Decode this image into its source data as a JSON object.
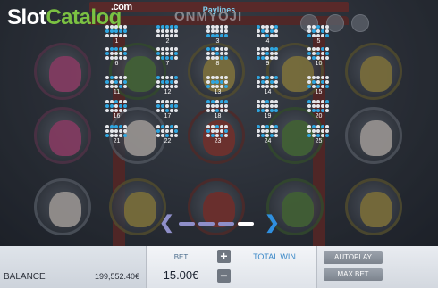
{
  "logo": {
    "slot": "Slot",
    "catalog": "Catalog",
    "com": ".com"
  },
  "game_title": "ONMYOJI",
  "paylines": {
    "title": "Paylines",
    "lines": [
      {
        "num": "1",
        "rows": [
          1,
          1,
          1,
          1,
          1
        ]
      },
      {
        "num": "2",
        "rows": [
          0,
          0,
          0,
          0,
          0
        ]
      },
      {
        "num": "3",
        "rows": [
          2,
          2,
          2,
          2,
          2
        ]
      },
      {
        "num": "4",
        "rows": [
          0,
          1,
          2,
          1,
          0
        ]
      },
      {
        "num": "5",
        "rows": [
          2,
          1,
          0,
          1,
          2
        ]
      },
      {
        "num": "6",
        "rows": [
          1,
          0,
          0,
          0,
          1
        ]
      },
      {
        "num": "7",
        "rows": [
          1,
          2,
          2,
          2,
          1
        ]
      },
      {
        "num": "8",
        "rows": [
          0,
          0,
          1,
          2,
          2
        ]
      },
      {
        "num": "9",
        "rows": [
          2,
          2,
          1,
          0,
          0
        ]
      },
      {
        "num": "10",
        "rows": [
          1,
          2,
          1,
          0,
          1
        ]
      },
      {
        "num": "11",
        "rows": [
          1,
          0,
          1,
          2,
          1
        ]
      },
      {
        "num": "12",
        "rows": [
          0,
          1,
          1,
          1,
          0
        ]
      },
      {
        "num": "13",
        "rows": [
          2,
          1,
          1,
          1,
          2
        ]
      },
      {
        "num": "14",
        "rows": [
          0,
          1,
          0,
          1,
          0
        ]
      },
      {
        "num": "15",
        "rows": [
          2,
          1,
          2,
          1,
          2
        ]
      },
      {
        "num": "16",
        "rows": [
          1,
          1,
          0,
          1,
          1
        ]
      },
      {
        "num": "17",
        "rows": [
          1,
          1,
          2,
          1,
          1
        ]
      },
      {
        "num": "18",
        "rows": [
          0,
          0,
          2,
          0,
          0
        ]
      },
      {
        "num": "19",
        "rows": [
          2,
          2,
          0,
          2,
          2
        ]
      },
      {
        "num": "20",
        "rows": [
          0,
          2,
          2,
          2,
          0
        ]
      },
      {
        "num": "21",
        "rows": [
          2,
          0,
          0,
          0,
          2
        ]
      },
      {
        "num": "22",
        "rows": [
          1,
          0,
          2,
          0,
          1
        ]
      },
      {
        "num": "23",
        "rows": [
          1,
          2,
          0,
          2,
          1
        ]
      },
      {
        "num": "24",
        "rows": [
          0,
          2,
          0,
          2,
          0
        ]
      },
      {
        "num": "25",
        "rows": [
          2,
          0,
          2,
          0,
          2
        ]
      }
    ]
  },
  "pagination": {
    "pages": 4,
    "active_page": 4
  },
  "symbols": [
    "pink-fox",
    "green-oni",
    "gold-mask",
    "gold-mask",
    "gold-mask",
    "pink-fox",
    "girl",
    "red-oni",
    "green-oni",
    "girl",
    "girl",
    "gold-mask",
    "red-oni",
    "green-oni",
    "gold-mask"
  ],
  "bottom_bar": {
    "balance_label": "BALANCE",
    "balance_value": "199,552.40€",
    "bet_label": "BET",
    "bet_value": "15.00€",
    "plus_label": "+",
    "minus_label": "−",
    "total_win_label": "TOTAL WIN",
    "autoplay_label": "AUTOPLAY",
    "max_bet_label": "MAX BET"
  }
}
